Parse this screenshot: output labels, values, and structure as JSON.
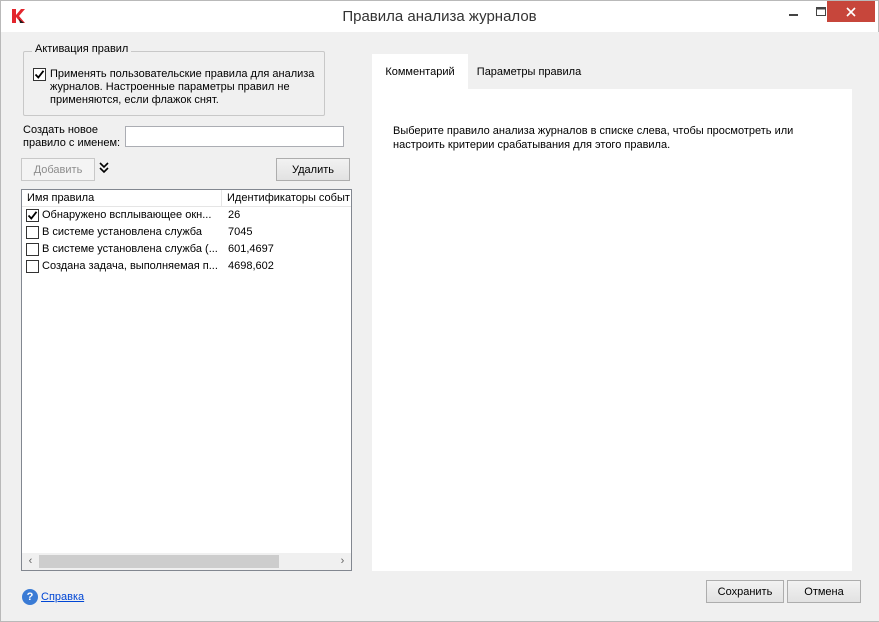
{
  "window": {
    "title": "Правила анализа журналов",
    "minimize_icon": "minimize-icon",
    "maximize_icon": "maximize-icon",
    "close_icon": "close-icon",
    "close_color": "#c7463b"
  },
  "activation": {
    "legend": "Активация правил",
    "apply_checked": true,
    "apply_text": "Применять пользовательские правила для анализа журналов. Настроенные параметры правил не применяются, если флажок снят."
  },
  "new_rule": {
    "label": "Создать новое правило с именем:",
    "value": "",
    "add_label": "Добавить",
    "delete_label": "Удалить"
  },
  "rules_list": {
    "columns": [
      "Имя правила",
      "Идентификаторы событ"
    ],
    "rows": [
      {
        "checked": true,
        "name": "Обнаружено всплывающее окн...",
        "ids": "26"
      },
      {
        "checked": false,
        "name": "В системе установлена служба",
        "ids": "7045"
      },
      {
        "checked": false,
        "name": "В системе установлена служба (...",
        "ids": "601,4697"
      },
      {
        "checked": false,
        "name": "Создана задача, выполняемая п...",
        "ids": "4698,602"
      }
    ]
  },
  "tabs": {
    "comment": "Комментарий",
    "params": "Параметры правила",
    "active": "comment"
  },
  "comment_text": "Выберите правило анализа журналов в списке слева, чтобы просмотреть или настроить критерии срабатывания для этого правила.",
  "footer": {
    "help_label": "Справка",
    "save_label": "Сохранить",
    "cancel_label": "Отмена"
  }
}
